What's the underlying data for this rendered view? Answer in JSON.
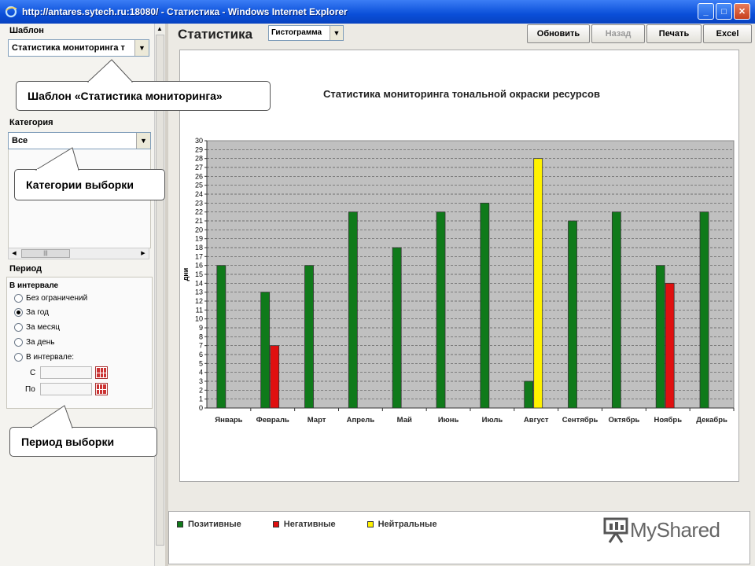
{
  "window": {
    "title": "http://antares.sytech.ru:18080/ - Статистика - Windows Internet Explorer",
    "buttons": [
      "_",
      "□",
      "✕"
    ]
  },
  "sidebar": {
    "template_label": "Шаблон",
    "template_value": "Статистика мониторинга т",
    "category_label": "Категория",
    "category_value": "Все",
    "period_label": "Период",
    "interval_heading": "В интервале",
    "period_options": [
      {
        "label": "Без ограничений",
        "checked": false
      },
      {
        "label": "За год",
        "checked": true
      },
      {
        "label": "За месяц",
        "checked": false
      },
      {
        "label": "За день",
        "checked": false
      },
      {
        "label": "В интервале:",
        "checked": false
      }
    ],
    "from_label": "С",
    "to_label": "По"
  },
  "callouts": {
    "template": "Шаблон «Статистика мониторинга»",
    "category": "Категории выборки",
    "period": "Период выборки"
  },
  "toolbar": {
    "page_title": "Статистика",
    "chart_type": "Гистограмма",
    "refresh": "Обновить",
    "back": "Назад",
    "print": "Печать",
    "excel": "Excel"
  },
  "legend": {
    "positive": "Позитивные",
    "negative": "Негативные",
    "neutral": "Нейтральные"
  },
  "watermark": "MyShared",
  "colors": {
    "positive": "#0f7a1a",
    "negative": "#e01010",
    "neutral": "#fff200",
    "plot_bg": "#c0c0c0"
  },
  "chart_data": {
    "type": "bar",
    "title": "Статистика мониторинга тональной окраски ресурсов",
    "ylabel": "дни",
    "xlabel": "",
    "ylim": [
      0,
      30
    ],
    "grid": true,
    "categories": [
      "Январь",
      "Февраль",
      "Март",
      "Апрель",
      "Май",
      "Июнь",
      "Июль",
      "Август",
      "Сентябрь",
      "Октябрь",
      "Ноябрь",
      "Декабрь"
    ],
    "series": [
      {
        "name": "Позитивные",
        "color": "#0f7a1a",
        "values": [
          16,
          13,
          16,
          22,
          18,
          22,
          23,
          3,
          21,
          22,
          16,
          22
        ]
      },
      {
        "name": "Негативные",
        "color": "#e01010",
        "values": [
          0,
          7,
          0,
          0,
          0,
          0,
          0,
          0,
          0,
          0,
          14,
          0
        ]
      },
      {
        "name": "Нейтральные",
        "color": "#fff200",
        "values": [
          0,
          0,
          0,
          0,
          0,
          0,
          0,
          28,
          0,
          0,
          0,
          0
        ]
      }
    ]
  }
}
